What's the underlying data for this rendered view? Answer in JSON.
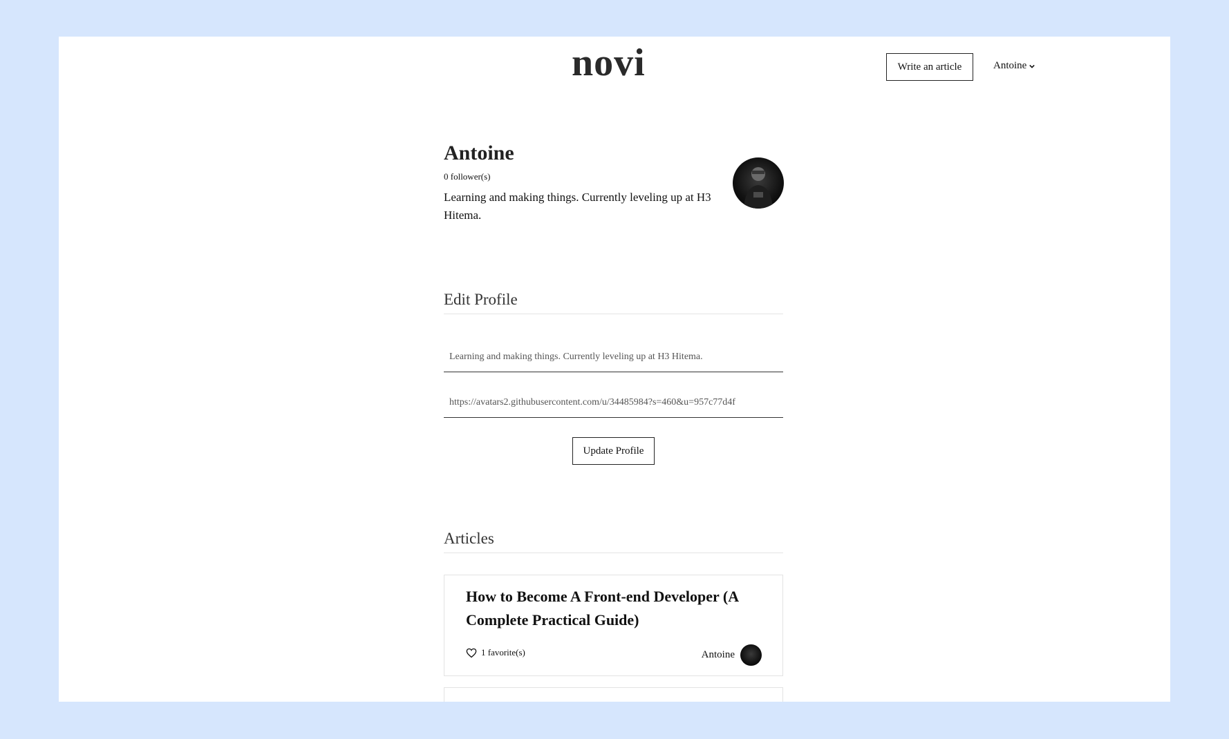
{
  "header": {
    "logo": "novi",
    "write_label": "Write an article",
    "user_label": "Antoine"
  },
  "profile": {
    "name": "Antoine",
    "followers": "0 follower(s)",
    "bio": "Learning and making things. Currently leveling up at H3 Hitema."
  },
  "edit_profile": {
    "title": "Edit Profile",
    "bio_value": "Learning and making things. Currently leveling up at H3 Hitema.",
    "avatar_url_value": "https://avatars2.githubusercontent.com/u/34485984?s=460&u=957c77d4f",
    "update_label": "Update Profile"
  },
  "articles": {
    "title": "Articles",
    "items": [
      {
        "title": "How to Become A Front-end Developer (A Complete Practical Guide)",
        "favorites": "1 favorite(s)",
        "author": "Antoine"
      }
    ]
  },
  "colors": {
    "background": "#d6e6fd",
    "page": "#ffffff",
    "text": "#111111"
  }
}
